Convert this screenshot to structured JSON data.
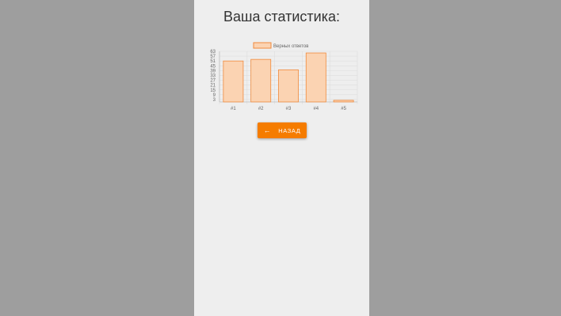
{
  "screen": {
    "title": "Ваша статистика:"
  },
  "back_button": {
    "label": "НАЗАД",
    "icon": "arrow-left-icon"
  },
  "colors": {
    "outer_background": "#9e9e9e",
    "panel_background": "#eeeeee",
    "bar_fill": "#fbd3b2",
    "bar_stroke": "#f08a3c",
    "accent": "#f57c00"
  },
  "chart_data": {
    "type": "bar",
    "categories": [
      "#1",
      "#2",
      "#3",
      "#4",
      "#5"
    ],
    "series": [
      {
        "name": "Верных ответов",
        "values": [
          51,
          53,
          40,
          61,
          2
        ]
      }
    ],
    "yticks": [
      3,
      9,
      15,
      21,
      27,
      33,
      39,
      45,
      51,
      57,
      63
    ],
    "ylim": [
      0,
      63
    ],
    "grid": true,
    "legend": "top-center"
  }
}
